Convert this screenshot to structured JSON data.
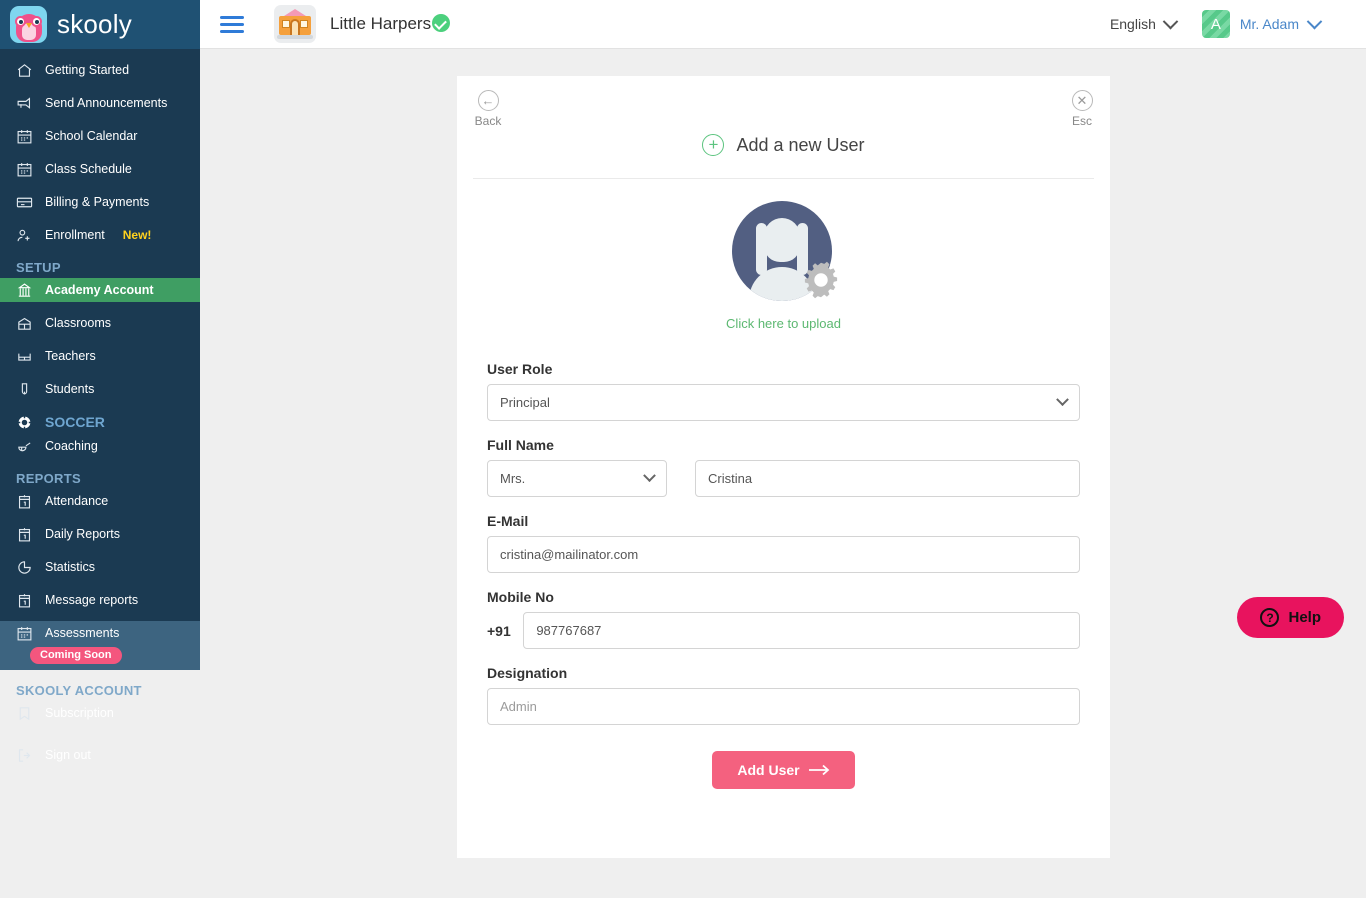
{
  "brand": {
    "name": "skooly",
    "logo_icon": "owl-icon"
  },
  "sidebar": {
    "items": [
      {
        "label": "Getting Started",
        "icon": "home-icon"
      },
      {
        "label": "Send Announcements",
        "icon": "megaphone-icon"
      },
      {
        "label": "School Calendar",
        "icon": "calendar-icon"
      },
      {
        "label": "Class Schedule",
        "icon": "calendar-icon"
      },
      {
        "label": "Billing & Payments",
        "icon": "wallet-icon"
      },
      {
        "label": "Enrollment",
        "icon": "person-add-icon",
        "badge": "New!"
      }
    ],
    "setup_section": "SETUP",
    "setup_items": [
      {
        "label": "Academy Account",
        "icon": "academy-icon",
        "active": true
      },
      {
        "label": "Classrooms",
        "icon": "classroom-icon"
      },
      {
        "label": "Teachers",
        "icon": "teacher-icon"
      },
      {
        "label": "Students",
        "icon": "student-icon"
      }
    ],
    "soccer_section": "SOCCER",
    "soccer_items": [
      {
        "label": "Coaching",
        "icon": "whistle-icon"
      }
    ],
    "reports_section": "REPORTS",
    "reports_items": [
      {
        "label": "Attendance",
        "icon": "attendance-icon"
      },
      {
        "label": "Daily Reports",
        "icon": "report-icon"
      },
      {
        "label": "Statistics",
        "icon": "pie-chart-icon"
      },
      {
        "label": "Message reports",
        "icon": "report-icon"
      },
      {
        "label": "Assessments",
        "icon": "calendar-icon",
        "badge": "Coming Soon",
        "highlight": true
      }
    ],
    "account_section": "SKOOLY ACCOUNT",
    "account_items": [
      {
        "label": "Subscription",
        "icon": "bookmark-icon"
      },
      {
        "label": "Sign out",
        "icon": "signout-icon"
      }
    ]
  },
  "header": {
    "menu_icon": "hamburger-icon",
    "school_icon": "school-icon",
    "school_name": "Little Harpers",
    "verified_icon": "verified-check-icon",
    "language": "English",
    "language_chevron": "chevron-down-icon",
    "user_initial": "A",
    "user_name": "Mr. Adam",
    "user_chevron": "chevron-down-icon"
  },
  "modal": {
    "back_label": "Back",
    "back_icon": "arrow-left-circle-icon",
    "esc_label": "Esc",
    "esc_icon": "close-circle-icon",
    "title": "Add a new User",
    "title_icon": "plus-circle-icon",
    "avatar_icon": "user-avatar-placeholder-icon",
    "gear_icon": "gear-icon",
    "upload_text": "Click here to upload",
    "fields": {
      "user_role": {
        "label": "User Role",
        "value": "Principal",
        "chevron": "chevron-down-icon"
      },
      "full_name": {
        "label": "Full Name",
        "salutation": "Mrs.",
        "salutation_chevron": "chevron-down-icon",
        "name_value": "Cristina"
      },
      "email": {
        "label": "E-Mail",
        "value": "cristina@mailinator.com"
      },
      "mobile": {
        "label": "Mobile No",
        "country_code": "+91",
        "value": "987767687"
      },
      "designation": {
        "label": "Designation",
        "placeholder": "Admin"
      }
    },
    "submit_label": "Add User",
    "submit_arrow": "arrow-right-icon"
  },
  "help": {
    "label": "Help",
    "icon": "question-circle-icon"
  },
  "colors": {
    "sidebar_bg": "#1b3a52",
    "sidebar_logo_bg": "#1f5173",
    "active_green": "#3f9e63",
    "highlight_blue": "#3d6480",
    "accent_pink": "#f4617f",
    "help_pink": "#e8135e",
    "badge_yellow": "#ffd21e",
    "link_green": "#5cb871",
    "page_bg": "#efefef"
  }
}
